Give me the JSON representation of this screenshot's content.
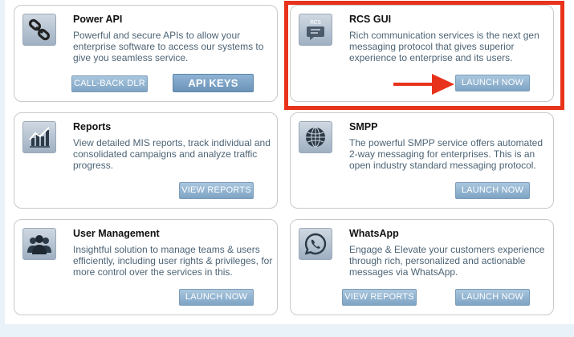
{
  "colors": {
    "background": "#eaf2f9",
    "button": "#8fb0cd",
    "highlight": "#e8331c",
    "description": "#4d6475"
  },
  "cards": [
    {
      "title": "Power API",
      "icon": "link-chain-icon",
      "description": "Powerful and secure APIs to allow your enterprise software to access our systems to give you seamless service.",
      "buttons": [
        "CALL-BACK DLR",
        "API KEYS"
      ]
    },
    {
      "title": "RCS GUI",
      "icon": "rcs-chat-icon",
      "icon_text": "RCS",
      "description": "Rich communication services is the next gen messaging protocol that gives superior experience to enterprise and its users.",
      "buttons": [
        "LAUNCH NOW"
      ]
    },
    {
      "title": "Reports",
      "icon": "bar-chart-icon",
      "description": "View detailed MIS reports, track individual and consolidated campaigns and analyze traffic progress.",
      "buttons": [
        "VIEW REPORTS"
      ]
    },
    {
      "title": "SMPP",
      "icon": "globe-icon",
      "description": "The powerful SMPP service offers automated 2-way messaging for enterprises. This is an open industry standard messaging protocol.",
      "buttons": [
        "LAUNCH NOW"
      ]
    },
    {
      "title": "User Management",
      "icon": "users-group-icon",
      "description": "Insightful solution to manage teams & users efficiently, including user rights & privileges, for more control over the services in this.",
      "buttons": [
        "LAUNCH NOW"
      ]
    },
    {
      "title": "WhatsApp",
      "icon": "whatsapp-icon",
      "description": "Engage & Elevate your customers experience through rich, personalized and actionable messages via WhatsApp.",
      "buttons": [
        "VIEW REPORTS",
        "LAUNCH NOW"
      ]
    }
  ]
}
